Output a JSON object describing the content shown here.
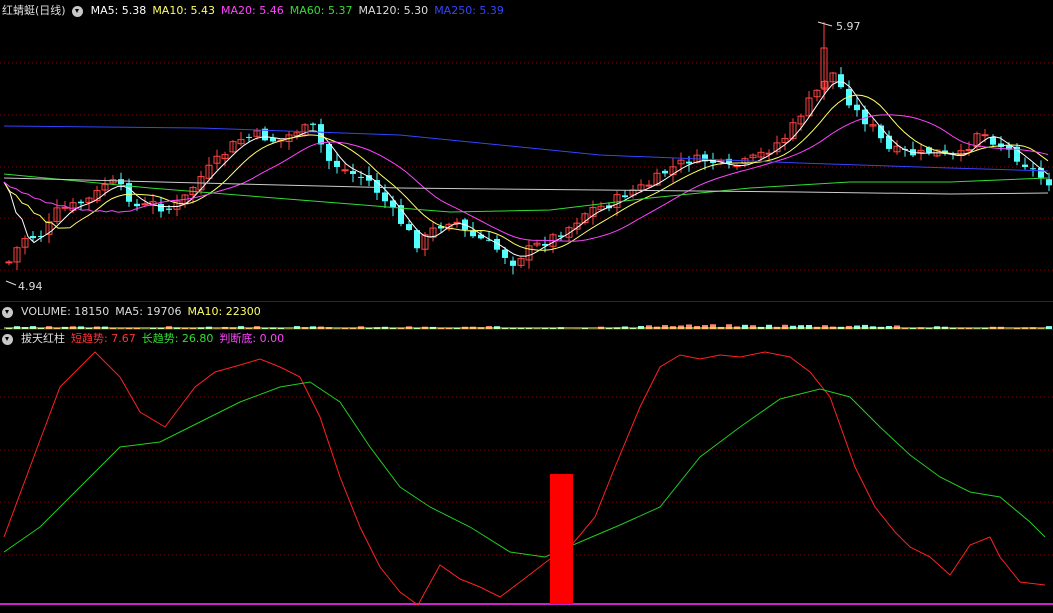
{
  "main_panel": {
    "title": "红蜻蜓(日线)",
    "indicators": [
      {
        "label": "MA5: 5.38",
        "color": "#ffffff"
      },
      {
        "label": "MA10: 5.43",
        "color": "#ffff66"
      },
      {
        "label": "MA20: 5.46",
        "color": "#ff44ff"
      },
      {
        "label": "MA60: 5.37",
        "color": "#33dd33"
      },
      {
        "label": "MA120: 5.30",
        "color": "#dddddd"
      },
      {
        "label": "MA250: 5.39",
        "color": "#3344ff"
      }
    ],
    "high_label": "5.97",
    "low_label": "4.94"
  },
  "volume_panel": {
    "indicators": [
      {
        "label": "VOLUME: 18150",
        "color": "#dddddd"
      },
      {
        "label": "MA5: 19706",
        "color": "#dddddd"
      },
      {
        "label": "MA10: 22300",
        "color": "#ffff66"
      }
    ]
  },
  "indicator_panel": {
    "title": "拔天红柱",
    "indicators": [
      {
        "label": "短趋势: 7.67",
        "color": "#ff3333"
      },
      {
        "label": "长趋势: 26.80",
        "color": "#33dd33"
      },
      {
        "label": "判断底: 0.00",
        "color": "#ff44ff"
      }
    ]
  },
  "colors": {
    "up_candle": "#ff4444",
    "down_candle": "#54ffff",
    "short_trend": "#ff2222",
    "long_trend": "#22cc22",
    "bottom_signal": "#ff0000",
    "grid": "#8b0000"
  }
}
